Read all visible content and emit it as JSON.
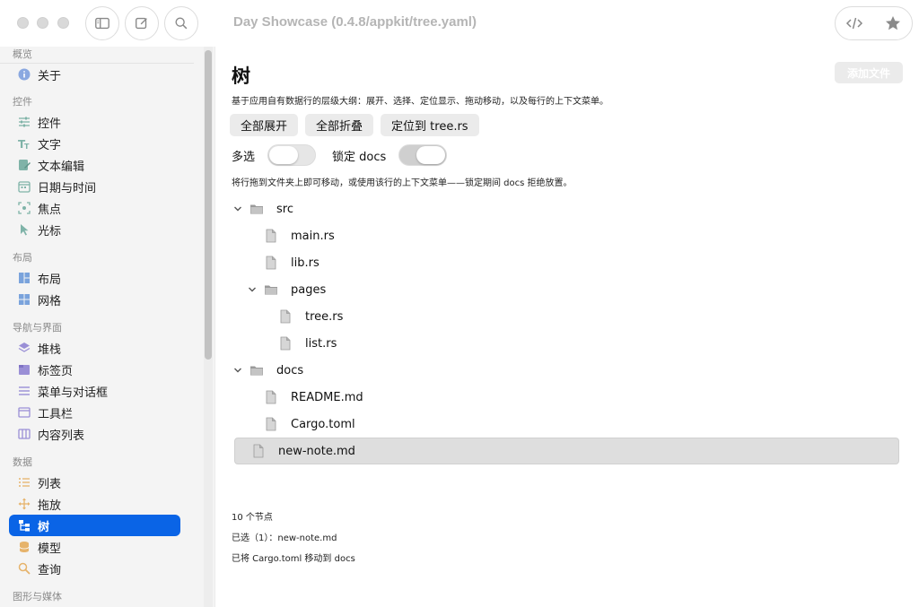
{
  "window": {
    "title": "Day Showcase (0.4.8/appkit/tree.yaml)"
  },
  "toolbar": {
    "sidebar_icon": "sidebar-icon",
    "compose_icon": "compose-icon",
    "search_icon": "search-icon",
    "code_icon": "code-icon",
    "star_icon": "star-icon"
  },
  "sidebar": {
    "sections": [
      {
        "title": "概览",
        "items": [
          {
            "label": "关于",
            "icon": "info-icon"
          }
        ]
      },
      {
        "title": "控件",
        "items": [
          {
            "label": "控件",
            "icon": "sliders-icon"
          },
          {
            "label": "文字",
            "icon": "text-icon"
          },
          {
            "label": "文本编辑",
            "icon": "edit-icon"
          },
          {
            "label": "日期与时间",
            "icon": "calendar-icon"
          },
          {
            "label": "焦点",
            "icon": "focus-icon"
          },
          {
            "label": "光标",
            "icon": "cursor-icon"
          }
        ]
      },
      {
        "title": "布局",
        "items": [
          {
            "label": "布局",
            "icon": "layout-icon"
          },
          {
            "label": "网格",
            "icon": "grid-icon"
          }
        ]
      },
      {
        "title": "导航与界面",
        "items": [
          {
            "label": "堆栈",
            "icon": "stack-icon"
          },
          {
            "label": "标签页",
            "icon": "tabs-icon"
          },
          {
            "label": "菜单与对话框",
            "icon": "menu-icon"
          },
          {
            "label": "工具栏",
            "icon": "toolbar-icon"
          },
          {
            "label": "内容列表",
            "icon": "columns-icon"
          }
        ]
      },
      {
        "title": "数据",
        "items": [
          {
            "label": "列表",
            "icon": "list-icon"
          },
          {
            "label": "拖放",
            "icon": "move-icon"
          },
          {
            "label": "树",
            "icon": "tree-icon",
            "active": true
          },
          {
            "label": "模型",
            "icon": "database-icon"
          },
          {
            "label": "查询",
            "icon": "query-icon"
          }
        ]
      },
      {
        "title": "图形与媒体",
        "items": []
      }
    ]
  },
  "main": {
    "title": "树",
    "add_file_label": "添加文件",
    "subtitle": "基于应用自有数据行的层级大纲：展开、选择、定位显示、拖动移动，以及每行的上下文菜单。",
    "buttons": {
      "expand_all": "全部展开",
      "collapse_all": "全部折叠",
      "reveal": "定位到 tree.rs"
    },
    "toggles": {
      "multi_select": "多选",
      "lock_docs": "锁定 docs"
    },
    "multi_select_on": false,
    "lock_docs_on": true,
    "hint": "将行拖到文件夹上即可移动，或使用该行的上下文菜单——锁定期间 docs 拒绝放置。",
    "tree": [
      {
        "label": "src",
        "type": "folder",
        "depth": 0,
        "expanded": true
      },
      {
        "label": "main.rs",
        "type": "file",
        "depth": 1
      },
      {
        "label": "lib.rs",
        "type": "file",
        "depth": 1
      },
      {
        "label": "pages",
        "type": "folder",
        "depth": 1,
        "expanded": true
      },
      {
        "label": "tree.rs",
        "type": "file",
        "depth": 2
      },
      {
        "label": "list.rs",
        "type": "file",
        "depth": 2
      },
      {
        "label": "docs",
        "type": "folder",
        "depth": 0,
        "expanded": true
      },
      {
        "label": "README.md",
        "type": "file",
        "depth": 1
      },
      {
        "label": "Cargo.toml",
        "type": "file",
        "depth": 1
      },
      {
        "label": "new-note.md",
        "type": "file",
        "depth": 0,
        "selected": true
      }
    ],
    "status": {
      "count": "10 个节点",
      "selection": "已选（1）：new-note.md",
      "last_action": "已将 Cargo.toml 移动到 docs"
    }
  }
}
